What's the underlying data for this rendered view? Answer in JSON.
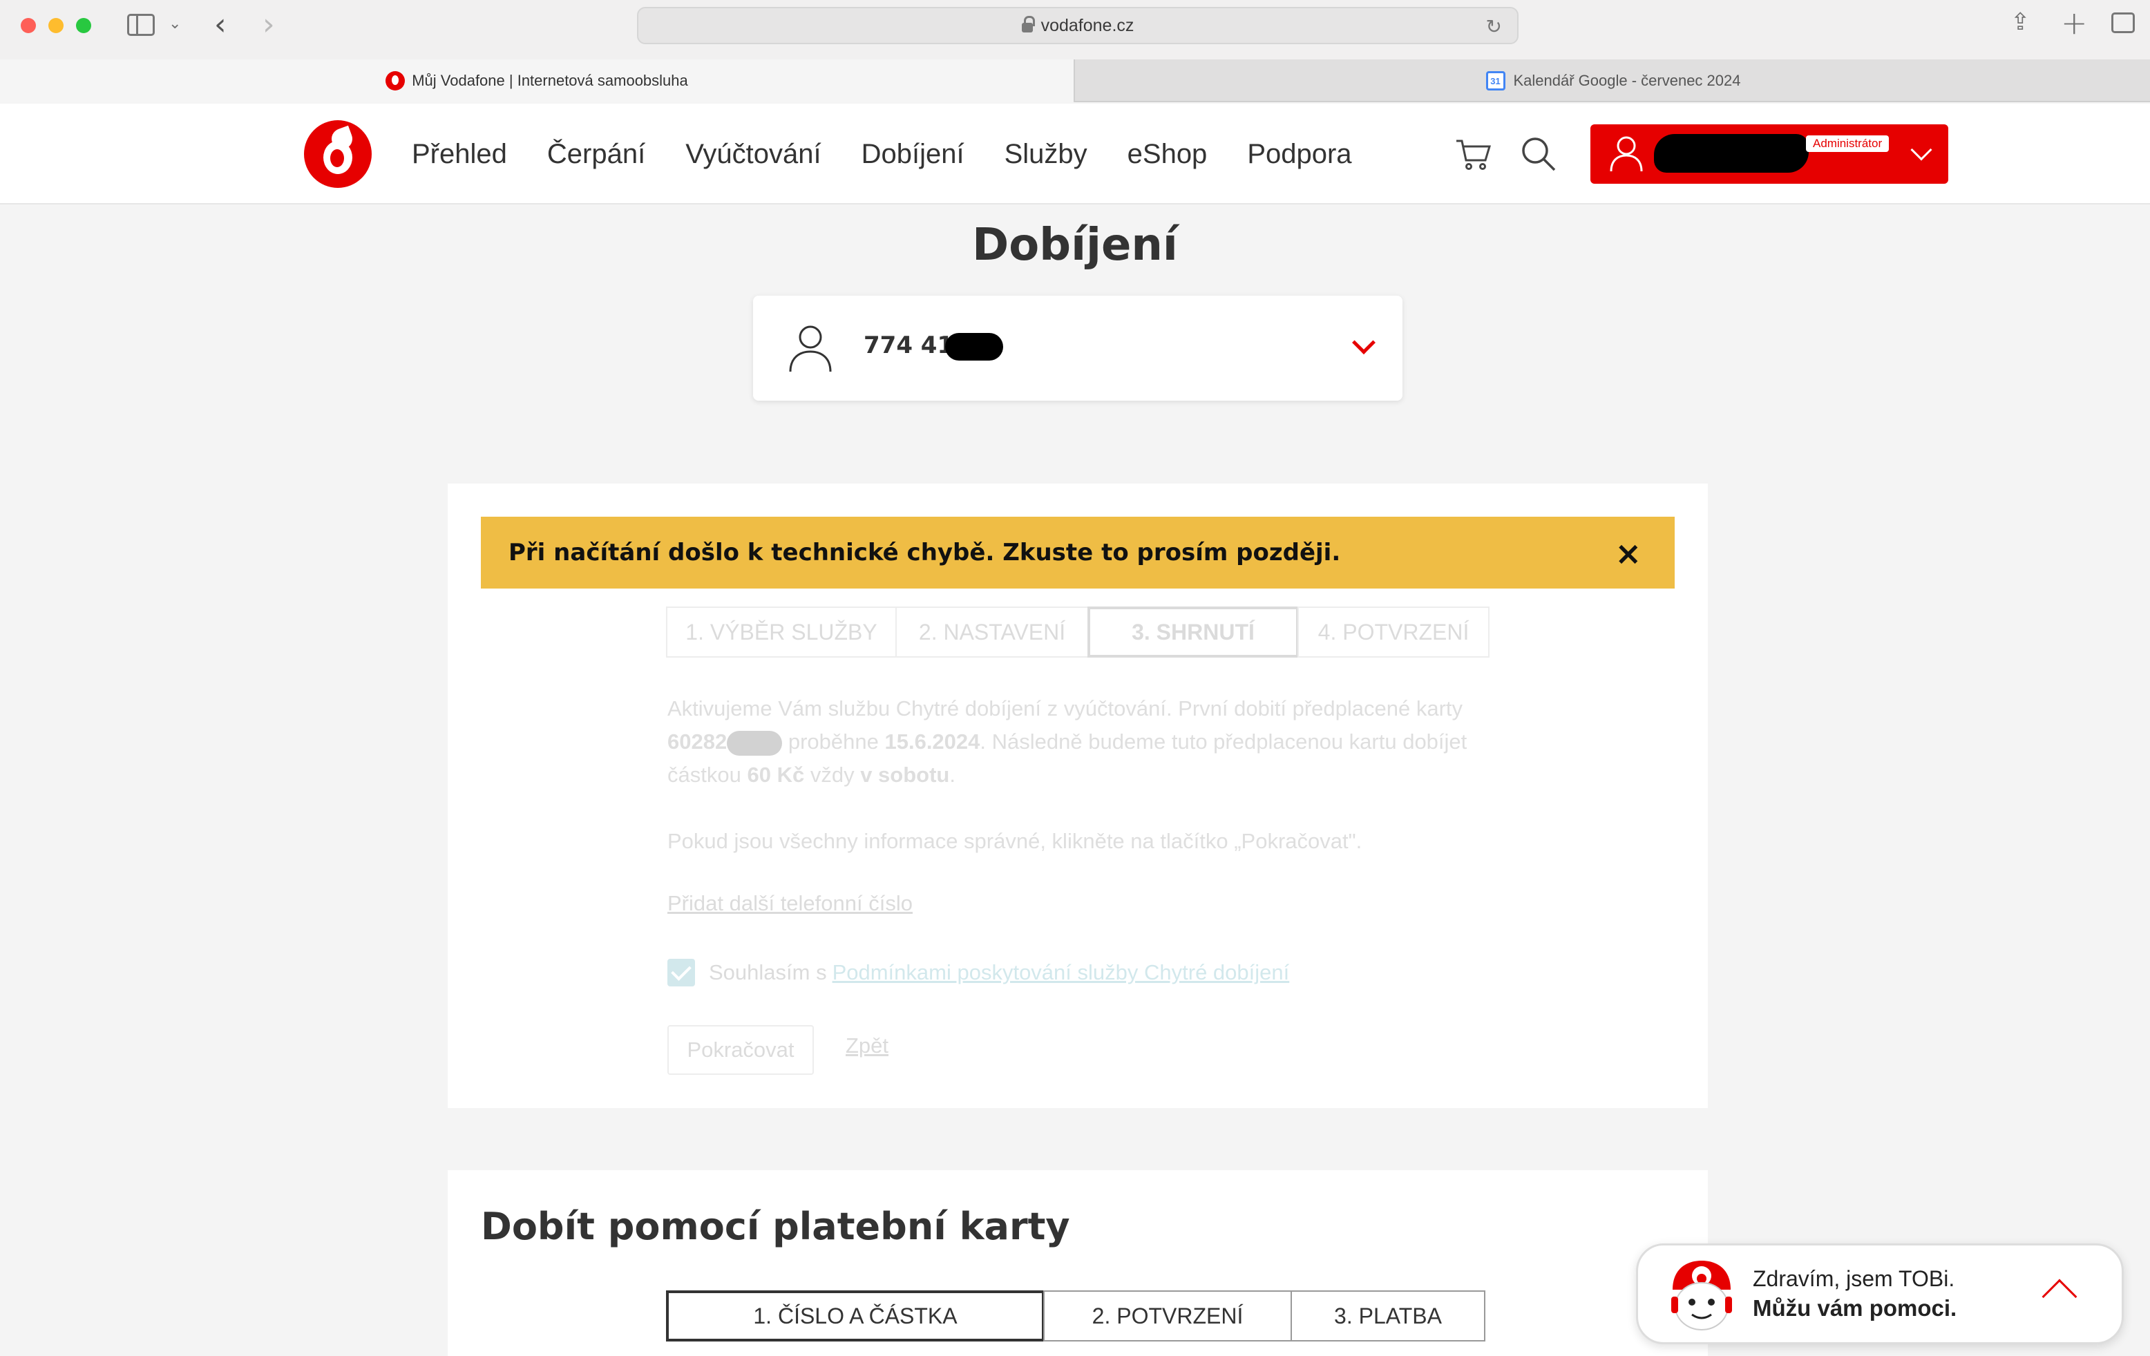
{
  "browser": {
    "url": "vodafone.cz",
    "tabs": [
      {
        "label": "Můj Vodafone | Internetová samoobsluha",
        "active": true,
        "icon": "vodafone-favicon"
      },
      {
        "label": "Kalendář Google - červenec 2024",
        "active": false,
        "icon": "google-calendar-favicon",
        "icon_text": "31"
      }
    ]
  },
  "header": {
    "nav": [
      "Přehled",
      "Čerpání",
      "Vyúčtování",
      "Dobíjení",
      "Služby",
      "eShop",
      "Podpora"
    ],
    "account_badge": "Administrátor",
    "icons": [
      "cart-icon",
      "search-icon",
      "user-icon",
      "chevron-down-icon"
    ],
    "accent_color": "#e60000"
  },
  "page": {
    "title": "Dobíjení",
    "phone_number_prefix": "774 410"
  },
  "warning": {
    "text": "Při načítání došlo k technické chybě. Zkuste to prosím později.",
    "close_label": "×",
    "color": "#efbd45"
  },
  "wizard": {
    "steps": [
      "1. VÝBĚR SLUŽBY",
      "2. NASTAVENÍ",
      "3. SHRNUTÍ",
      "4. POTVRZENÍ"
    ],
    "active_step": 3,
    "summary": {
      "part1": "Aktivujeme Vám službu Chytré dobíjení z vyúčtování. První dobití předplacené karty",
      "card_prefix": "60282",
      "part2": "proběhne",
      "date": "15.6.2024",
      "part3": ". Následně budeme tuto předplacenou kartu dobíjet částkou",
      "amount": "60 Kč",
      "part4": "vždy",
      "day": "v sobotu",
      "part5": "."
    },
    "confirm_text": "Pokud jsou všechny informace správné, klikněte na tlačítko „Pokračovat\".",
    "add_number_link": "Přidat další telefonní číslo",
    "agree_prefix": "Souhlasím s",
    "agree_link": "Podmínkami poskytování služby Chytré dobíjení",
    "continue_label": "Pokračovat",
    "back_label": "Zpět"
  },
  "card_payment": {
    "title": "Dobít pomocí platební karty",
    "steps": [
      "1. ČÍSLO A ČÁSTKA",
      "2. POTVRZENÍ",
      "3. PLATBA"
    ]
  },
  "chat": {
    "greeting": "Zdravím, jsem TOBi.",
    "help": "Můžu vám pomoci."
  }
}
